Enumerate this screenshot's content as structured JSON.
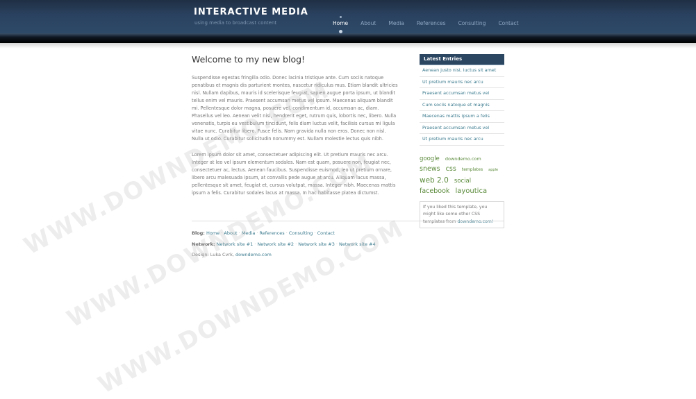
{
  "header": {
    "title": "INTERACTIVE MEDIA",
    "slogan": "using media to broadcast content",
    "nav": [
      "Home",
      "About",
      "Media",
      "References",
      "Consulting",
      "Contact"
    ],
    "active_nav": "Home"
  },
  "post": {
    "title": "Welcome to my new blog!",
    "paragraphs": [
      "Suspendisse egestas fringilla odio. Donec lacinia tristique ante. Cum sociis natoque penatibus et magnis dis parturient montes, nascetur ridiculus mus. Etiam blandit ultricies nisl. Nullam dapibus, mauris id scelerisque feugiat, sapien augue porta ipsum, ut blandit tellus enim vel mauris. Praesent accumsan metus vel ipsum. Maecenas aliquam blandit mi. Pellentesque dolor magna, posuere vel, condimentum id, accumsan ac, diam. Phasellus vel leo. Aenean velit nisl, hendrerit eget, rutrum quis, lobortis nec, libero. Nulla venenatis, turpis eu vestibulum tincidunt, felis diam luctus velit, facilisis cursus mi ligula vitae nunc. Curabitur libero. Fusce felis. Nam gravida nulla non eros. Donec non nisl. Nulla ut odio. Curabitur sollicitudin nonummy est. Nullam molestie lectus quis nibh.",
      "Lorem ipsum dolor sit amet, consectetuer adipiscing elit. Ut pretium mauris nec arcu. Integer at leo vel ipsum elementum sodales. Nam est quam, posuere non, feugiat nec, consectetuer ac, lectus. Aenean faucibus. Suspendisse euismod, leo ut pretium ornare, libero arcu malesuada ipsum, at convallis pede augue at arcu. Aliquam lacus massa, pellentesque sit amet, feugiat et, cursus volutpat, massa. Integer nibh. Maecenas mattis ipsum a felis. Curabitur sodales lacus at massa. In hac habitasse platea dictumst."
    ]
  },
  "sidebar": {
    "heading": "Latest Entries",
    "entries": [
      "Aenean justo nisl, luctus sit amet",
      "Ut pretium mauris nec arcu",
      "Praesent accumsan metus vel",
      "Cum sociis natoque et magnis",
      "Maecenas mattis ipsum a felis",
      "Praesent accumsan metus vel",
      "Ut pretium mauris nec arcu"
    ],
    "tags": [
      {
        "text": "google",
        "size": 8.5
      },
      {
        "text": "downdemo.com",
        "size": 6.5
      },
      {
        "text": "snews",
        "size": 9.5
      },
      {
        "text": "css",
        "size": 9.5
      },
      {
        "text": "templates",
        "size": 6
      },
      {
        "text": "apple",
        "size": 5
      },
      {
        "text": "web 2.0",
        "size": 10.5
      },
      {
        "text": "social",
        "size": 8.5
      },
      {
        "text": "facebook",
        "size": 9.5
      },
      {
        "text": "layoutica",
        "size": 10
      }
    ],
    "note_text": "If you liked this template, you might like some other CSS templates from",
    "note_link": "downdemo.com!"
  },
  "footer": {
    "blog_label": "Blog:",
    "blog_links": [
      "Home",
      "About",
      "Media",
      "References",
      "Consulting",
      "Contact"
    ],
    "network_label": "Network:",
    "network_links": [
      "Network site #1",
      "Network site #2",
      "Network site #3",
      "Network site #4"
    ],
    "design_text": "Design: Luka Cvrk,",
    "design_link": "downdemo.com"
  },
  "watermark": {
    "text": "WWW.DOWNDEMO.COM"
  },
  "colors": {
    "header_bg": "#2a4260",
    "link": "#3a7a8e",
    "tag": "#5a8a3a",
    "sidebar_heading_bg": "#2b4661"
  }
}
